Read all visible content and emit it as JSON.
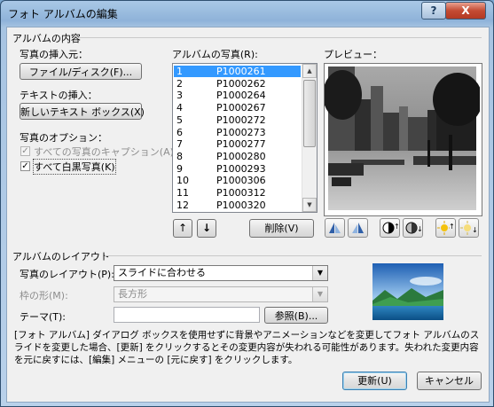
{
  "window": {
    "title": "フォト アルバムの編集",
    "help_label": "?",
    "close_label": "X"
  },
  "album_content": {
    "group_title": "アルバムの内容",
    "insert_photo_label": "写真の挿入元：",
    "file_disk_button": "ファイル/ディスク(F)...",
    "insert_text_label": "テキストの挿入：",
    "new_textbox_button": "新しいテキスト ボックス(X)",
    "photo_options_label": "写真のオプション：",
    "captions_checkbox": "すべての写真のキャプション(A)",
    "bw_checkbox": "すべて白黒写真(K)",
    "captions_checked": "✓",
    "bw_checked": "✓"
  },
  "photo_list": {
    "label": "アルバムの写真(R):",
    "items": [
      {
        "n": "1",
        "file": "P1000261"
      },
      {
        "n": "2",
        "file": "P1000262"
      },
      {
        "n": "3",
        "file": "P1000264"
      },
      {
        "n": "4",
        "file": "P1000267"
      },
      {
        "n": "5",
        "file": "P1000272"
      },
      {
        "n": "6",
        "file": "P1000273"
      },
      {
        "n": "7",
        "file": "P1000277"
      },
      {
        "n": "8",
        "file": "P1000280"
      },
      {
        "n": "9",
        "file": "P1000293"
      },
      {
        "n": "10",
        "file": "P1000306"
      },
      {
        "n": "11",
        "file": "P1000312"
      },
      {
        "n": "12",
        "file": "P1000320"
      }
    ],
    "move_up_icon": "↑",
    "move_down_icon": "↓",
    "delete_button": "削除(V)"
  },
  "preview": {
    "label": "プレビュー："
  },
  "layout": {
    "group_title": "アルバムのレイアウト",
    "picture_layout_label": "写真のレイアウト(P):",
    "picture_layout_value": "スライドに合わせる",
    "frame_shape_label": "枠の形(M):",
    "frame_shape_value": "長方形",
    "theme_label": "テーマ(T):",
    "theme_value": "",
    "browse_button": "参照(B)..."
  },
  "warning_text": "[フォト アルバム] ダイアログ ボックスを使用せずに背景やアニメーションなどを変更してフォト アルバムのスライドを変更した場合、[更新] をクリックするとその変更内容が失われる可能性があります。失われた変更内容を元に戻すには、[編集] メニューの [元に戻す] をクリックします。",
  "footer": {
    "update_button": "更新(U)",
    "cancel_button": "キャンセル"
  },
  "colors": {
    "selection": "#3399ff",
    "title_bar": "#8fb3d9",
    "close_button": "#c44b33"
  }
}
